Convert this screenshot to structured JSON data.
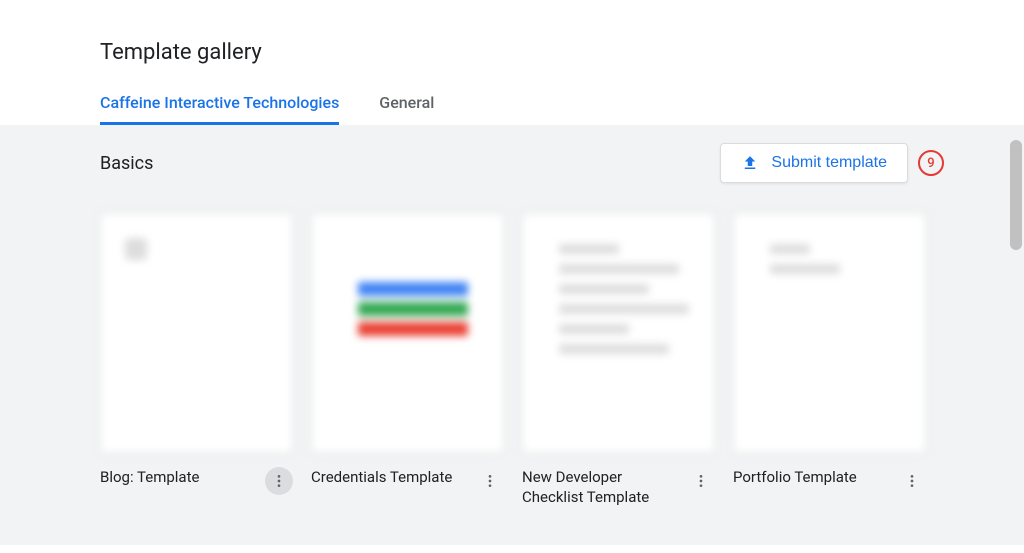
{
  "header": {
    "title": "Template gallery",
    "tabs": [
      {
        "label": "Caffeine Interactive Technologies",
        "active": true
      },
      {
        "label": "General",
        "active": false
      }
    ]
  },
  "section": {
    "title": "Basics",
    "submit_label": "Submit template"
  },
  "annotation": {
    "number": "9"
  },
  "templates": [
    {
      "name": "Blog: Template",
      "more_highlight": true
    },
    {
      "name": "Credentials Template",
      "more_highlight": false
    },
    {
      "name": "New Developer Checklist Template",
      "more_highlight": false
    },
    {
      "name": "Portfolio Template",
      "more_highlight": false
    }
  ]
}
